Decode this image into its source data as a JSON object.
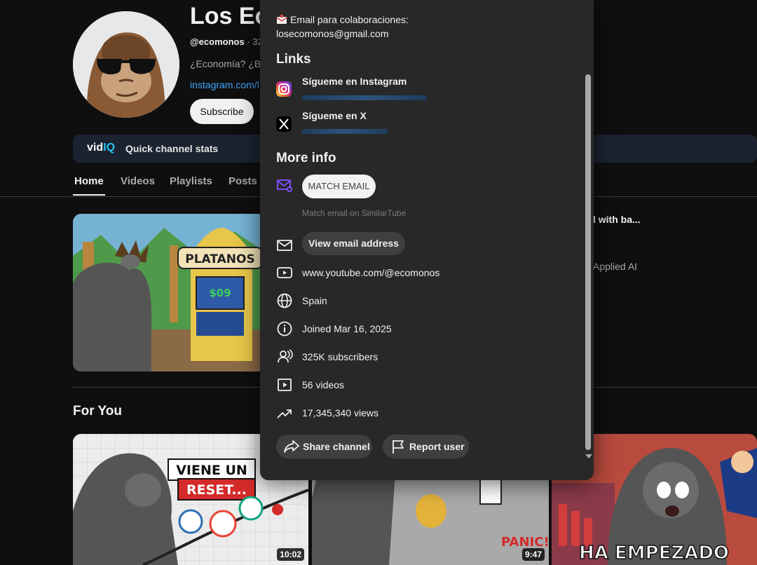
{
  "channel": {
    "title": "Los Ec",
    "handle": "@ecomonos",
    "handle_suffix": "· 32",
    "description": "¿Economía? ¿Bol",
    "link": "instagram.com/l",
    "subscribe_label": "Subscribe"
  },
  "vidiq": {
    "logo_main": "vid",
    "logo_accent": "IQ",
    "label": "Quick channel stats"
  },
  "tabs": [
    "Home",
    "Videos",
    "Playlists",
    "Posts"
  ],
  "featured": {
    "sign_text": "PLATANOS",
    "price_text": "$09",
    "side_title": "l with ba...",
    "side_meta": "Applied AI"
  },
  "for_you": {
    "heading": "For You",
    "videos": [
      {
        "caption_line1": "VIENE UN",
        "caption_line2": "RESET...",
        "duration": "10:02"
      },
      {
        "duration": "9:47"
      },
      {
        "caption": "HA EMPEZADO"
      }
    ]
  },
  "about": {
    "email_label": "Email para colaboraciones:",
    "email_value": "losecomonos@gmail.com",
    "links_heading": "Links",
    "links": [
      {
        "title": "Sígueme en Instagram",
        "icon": "instagram-icon"
      },
      {
        "title": "Sígueme en X",
        "icon": "x-icon"
      }
    ],
    "more_info_heading": "More info",
    "match_email_label": "MATCH EMAIL",
    "match_email_caption": "Match email on SimilarTube",
    "view_email_label": "View email address",
    "channel_url": "www.youtube.com/@ecomonos",
    "country": "Spain",
    "joined": "Joined Mar 16, 2025",
    "subscribers": "325K subscribers",
    "videos": "56 videos",
    "views": "17,345,340 views",
    "share_label": "Share channel",
    "report_label": "Report user"
  }
}
